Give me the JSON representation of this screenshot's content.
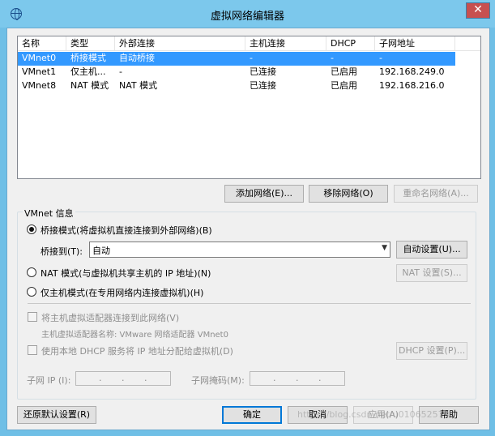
{
  "window": {
    "title": "虚拟网络编辑器",
    "close_label": "✕"
  },
  "network_list": {
    "columns": [
      "名称",
      "类型",
      "外部连接",
      "主机连接",
      "DHCP",
      "子网地址"
    ],
    "rows": [
      {
        "name": "VMnet0",
        "type": "桥接模式",
        "external": "自动桥接",
        "host": "-",
        "dhcp": "-",
        "subnet": "-",
        "selected": true
      },
      {
        "name": "VMnet1",
        "type": "仅主机...",
        "external": "-",
        "host": "已连接",
        "dhcp": "已启用",
        "subnet": "192.168.249.0",
        "selected": false
      },
      {
        "name": "VMnet8",
        "type": "NAT 模式",
        "external": "NAT 模式",
        "host": "已连接",
        "dhcp": "已启用",
        "subnet": "192.168.216.0",
        "selected": false
      }
    ]
  },
  "list_buttons": {
    "add": "添加网络(E)...",
    "remove": "移除网络(O)",
    "rename": "重命名网络(A)..."
  },
  "vmnet_info": {
    "group_title": "VMnet 信息",
    "bridged_label": "桥接模式(将虚拟机直接连接到外部网络)(B)",
    "bridged_to_label": "桥接到(T):",
    "bridged_to_value": "自动",
    "auto_settings": "自动设置(U)...",
    "nat_label": "NAT 模式(与虚拟机共享主机的 IP 地址)(N)",
    "nat_settings": "NAT 设置(S)...",
    "host_only_label": "仅主机模式(在专用网络内连接虚拟机)(H)",
    "connect_adapter_label": "将主机虚拟适配器连接到此网络(V)",
    "adapter_name_label": "主机虚拟适配器名称: VMware 网络适配器 VMnet0",
    "dhcp_label": "使用本地 DHCP 服务将 IP 地址分配给虚拟机(D)",
    "dhcp_settings": "DHCP 设置(P)...",
    "subnet_ip_label": "子网 IP (I):",
    "subnet_mask_label": "子网掩码(M):",
    "ip_dot": "."
  },
  "footer": {
    "restore": "还原默认设置(R)",
    "ok": "确定",
    "cancel": "取消",
    "apply": "应用(A)",
    "help": "帮助",
    "watermark": "https://blog.csdn.net/u010652573"
  }
}
